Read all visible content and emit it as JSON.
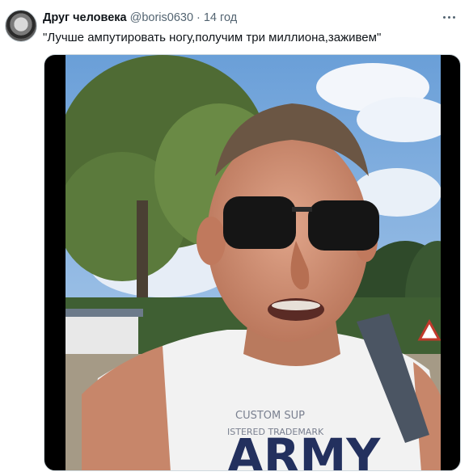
{
  "author": {
    "display_name": "Друг человека",
    "handle": "@boris0630",
    "separator": "·",
    "time": "14 год"
  },
  "tweet": {
    "text": "\"Лучше ампутировать ногу,получим три миллиона,заживем\""
  },
  "media": {
    "type": "video",
    "description_icons": [
      "more-options-icon"
    ]
  },
  "colors": {
    "secondary_text": "#536471",
    "primary_text": "#0f1419",
    "border": "#cfd9de"
  }
}
